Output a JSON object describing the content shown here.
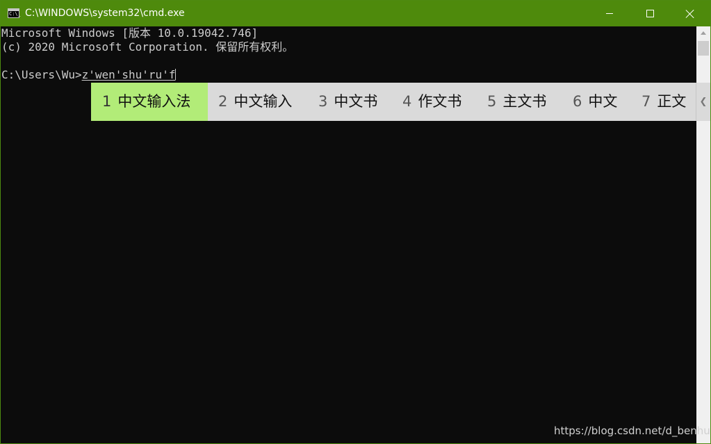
{
  "window": {
    "title": "C:\\WINDOWS\\system32\\cmd.exe",
    "icon_label": "C:\\_",
    "accent_color": "#4e8a0c"
  },
  "console": {
    "line1": "Microsoft Windows [版本 10.0.19042.746]",
    "line2": "(c) 2020 Microsoft Corporation. 保留所有权利。",
    "prompt": "C:\\Users\\Wu>",
    "composition": "z'wen'shu'ru'f"
  },
  "ime": {
    "selected_color": "#b2ec78",
    "candidates": [
      {
        "num": "1",
        "text": "中文输入法"
      },
      {
        "num": "2",
        "text": "中文输入"
      },
      {
        "num": "3",
        "text": "中文书"
      },
      {
        "num": "4",
        "text": "作文书"
      },
      {
        "num": "5",
        "text": "主文书"
      },
      {
        "num": "6",
        "text": "中文"
      },
      {
        "num": "7",
        "text": "正文"
      }
    ],
    "next_page_icon": "chevron-left-icon"
  },
  "watermark": "https://blog.csdn.net/d_benhu"
}
